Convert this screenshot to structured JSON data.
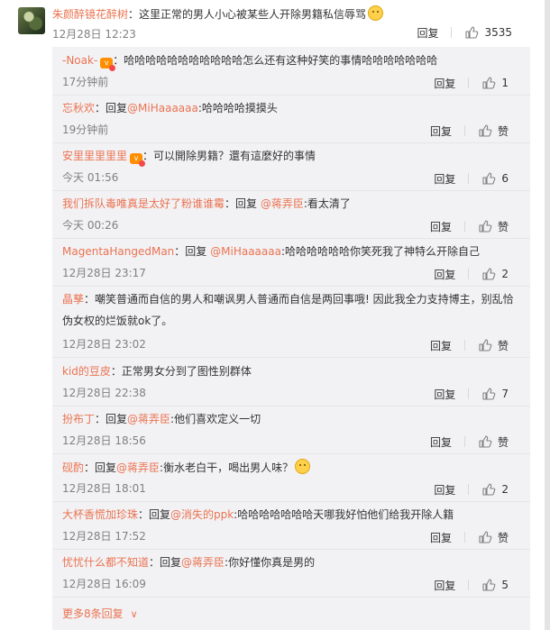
{
  "main_comment": {
    "user": "朱颜醉镜花醉树",
    "text": "：这里正常的男人小心被某些人开除男籍私信辱骂",
    "time": "12月28日 12:23",
    "reply": "回复",
    "likes": "3535"
  },
  "replies": [
    {
      "user": "-Noak-",
      "vip": true,
      "prefix": "",
      "mention": "",
      "text": "：哈哈哈哈哈哈哈哈哈哈哈怎么还有这种好笑的事情哈哈哈哈哈哈哈",
      "time": "17分钟前",
      "reply": "回复",
      "likes": "1"
    },
    {
      "user": "忘秋欢",
      "vip": false,
      "prefix": "：回复",
      "mention": "@MiHaaaaaa",
      "text": ":哈哈哈哈摸摸头",
      "time": "19分钟前",
      "reply": "回复",
      "likes": "赞"
    },
    {
      "user": "安里里里里里",
      "vip": true,
      "prefix": "",
      "mention": "",
      "text": "：可以開除男籍？還有這麼好的事情",
      "time": "今天 01:56",
      "reply": "回复",
      "likes": "6"
    },
    {
      "user": "我们拆队毒唯真是太好了粉谁谁霉",
      "vip": false,
      "prefix": "：回复 ",
      "mention": "@蒋弄臣",
      "text": ":看太清了",
      "time": "今天 00:26",
      "reply": "回复",
      "likes": "赞"
    },
    {
      "user": "MagentaHangedMan",
      "vip": false,
      "prefix": "：回复 ",
      "mention": "@MiHaaaaaa",
      "text": ":哈哈哈哈哈哈你笑死我了神特么开除自己",
      "time": "12月28日 23:17",
      "reply": "回复",
      "likes": "2"
    },
    {
      "user": "晶孳",
      "vip": false,
      "prefix": "",
      "mention": "",
      "text": "：嘲笑普通而自信的男人和嘲讽男人普通而自信是两回事哦! 因此我全力支持博主，别乱恰伪女权的烂饭就ok了。",
      "time": "12月28日 23:02",
      "reply": "回复",
      "likes": "赞"
    },
    {
      "user": "kid的豆皮",
      "vip": false,
      "prefix": "",
      "mention": "",
      "text": "：正常男女分到了图性别群体",
      "time": "12月28日 22:38",
      "reply": "回复",
      "likes": "7"
    },
    {
      "user": "扮布丁",
      "vip": false,
      "prefix": "：回复",
      "mention": "@蒋弄臣",
      "text": ":他们喜欢定义一切",
      "time": "12月28日 18:56",
      "reply": "回复",
      "likes": "赞"
    },
    {
      "user": "砚酌",
      "vip": false,
      "prefix": "：回复",
      "mention": "@蒋弄臣",
      "text": ":衡水老白干，喝出男人味？",
      "time": "12月28日 18:01",
      "reply": "回复",
      "likes": "2"
    },
    {
      "user": "大杯香慌加珍珠",
      "vip": false,
      "prefix": "：回复",
      "mention": "@消失的ppk",
      "text": ":哈哈哈哈哈哈哈天哪我好怕他们给我开除人籍",
      "time": "12月28日 17:52",
      "reply": "回复",
      "likes": "赞"
    },
    {
      "user": "忧忧什么都不知道",
      "vip": false,
      "prefix": "：回复",
      "mention": "@蒋弄臣",
      "text": ":你好懂你真是男的",
      "time": "12月28日 16:09",
      "reply": "回复",
      "likes": "5"
    }
  ],
  "more_replies": "更多8条回复",
  "colors": {
    "accent": "#eb7350",
    "panel": "#f2f2f5",
    "meta": "#808080"
  },
  "icons": {
    "like": "thumbs-up-icon",
    "expand": "chevron-down-icon",
    "emoji": "smile-emoji-icon"
  }
}
